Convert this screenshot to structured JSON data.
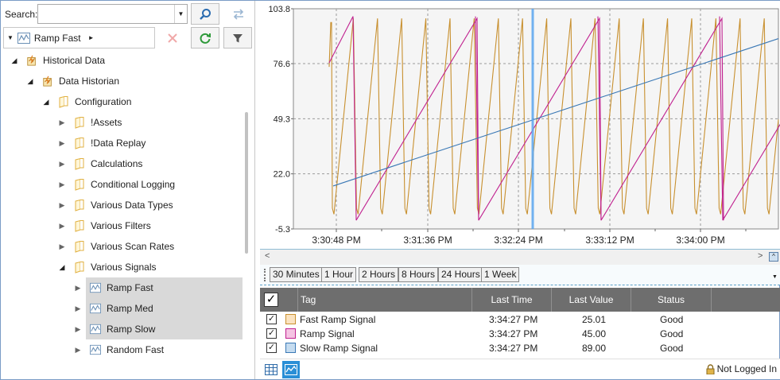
{
  "search": {
    "label": "Search:",
    "value": ""
  },
  "crumb": {
    "label": "Ramp Fast"
  },
  "tree": [
    {
      "label": "Historical Data",
      "level": 0,
      "expanded": true,
      "icon": "database-icon"
    },
    {
      "label": "Data Historian",
      "level": 1,
      "expanded": true,
      "icon": "database-icon"
    },
    {
      "label": "Configuration",
      "level": 2,
      "expanded": true,
      "icon": "folder-icon"
    },
    {
      "label": "!Assets",
      "level": 3,
      "expanded": false,
      "icon": "folder-icon"
    },
    {
      "label": "!Data Replay",
      "level": 3,
      "expanded": false,
      "icon": "folder-icon"
    },
    {
      "label": "Calculations",
      "level": 3,
      "expanded": false,
      "icon": "folder-icon"
    },
    {
      "label": "Conditional Logging",
      "level": 3,
      "expanded": false,
      "icon": "folder-icon"
    },
    {
      "label": "Various Data Types",
      "level": 3,
      "expanded": false,
      "icon": "folder-icon"
    },
    {
      "label": "Various Filters",
      "level": 3,
      "expanded": false,
      "icon": "folder-icon"
    },
    {
      "label": "Various Scan Rates",
      "level": 3,
      "expanded": false,
      "icon": "folder-icon"
    },
    {
      "label": "Various Signals",
      "level": 3,
      "expanded": true,
      "icon": "folder-icon"
    },
    {
      "label": "Ramp Fast",
      "level": 4,
      "expanded": false,
      "icon": "signal-icon",
      "selected": true
    },
    {
      "label": "Ramp Med",
      "level": 4,
      "expanded": false,
      "icon": "signal-icon",
      "selected": true
    },
    {
      "label": "Ramp Slow",
      "level": 4,
      "expanded": false,
      "icon": "signal-icon",
      "selected": true
    },
    {
      "label": "Random Fast",
      "level": 4,
      "expanded": false,
      "icon": "signal-icon",
      "selected": false
    }
  ],
  "chart_data": {
    "type": "line",
    "ylim": [
      -5.3,
      103.8
    ],
    "yticks": [
      "103.8",
      "76.6",
      "49.3",
      "22.0",
      "-5.3"
    ],
    "xticks": [
      "3:30:48 PM",
      "3:31:36 PM",
      "3:32:24 PM",
      "3:33:12 PM",
      "3:34:00 PM"
    ],
    "grid": true,
    "cursor_time": "3:32:20 PM",
    "series": [
      {
        "name": "Fast Ramp Signal",
        "color": "#c8902f",
        "kind": "fast-sawtooth"
      },
      {
        "name": "Ramp Signal",
        "color": "#c0208f",
        "kind": "medium-sawtooth"
      },
      {
        "name": "Slow Ramp Signal",
        "color": "#3a78b5",
        "kind": "slow-ramp"
      }
    ]
  },
  "ranges": [
    "30 Minutes",
    "1 Hour",
    "2 Hours",
    "8 Hours",
    "24 Hours",
    "1 Week"
  ],
  "grid": {
    "headers": {
      "tag": "Tag",
      "last_time": "Last Time",
      "last_value": "Last Value",
      "status": "Status"
    },
    "rows": [
      {
        "tag": "Fast Ramp Signal",
        "last_time": "3:34:27 PM",
        "last_value": "25.01",
        "status": "Good",
        "color": "#c8902f",
        "swatch_bg": "#fbe3c0"
      },
      {
        "tag": "Ramp Signal",
        "last_time": "3:34:27 PM",
        "last_value": "45.00",
        "status": "Good",
        "color": "#c0208f",
        "swatch_bg": "#f5c3e3"
      },
      {
        "tag": "Slow Ramp Signal",
        "last_time": "3:34:27 PM",
        "last_value": "89.00",
        "status": "Good",
        "color": "#3a78b5",
        "swatch_bg": "#c5dcf0"
      }
    ]
  },
  "footer": {
    "login_status": "Not Logged In"
  }
}
